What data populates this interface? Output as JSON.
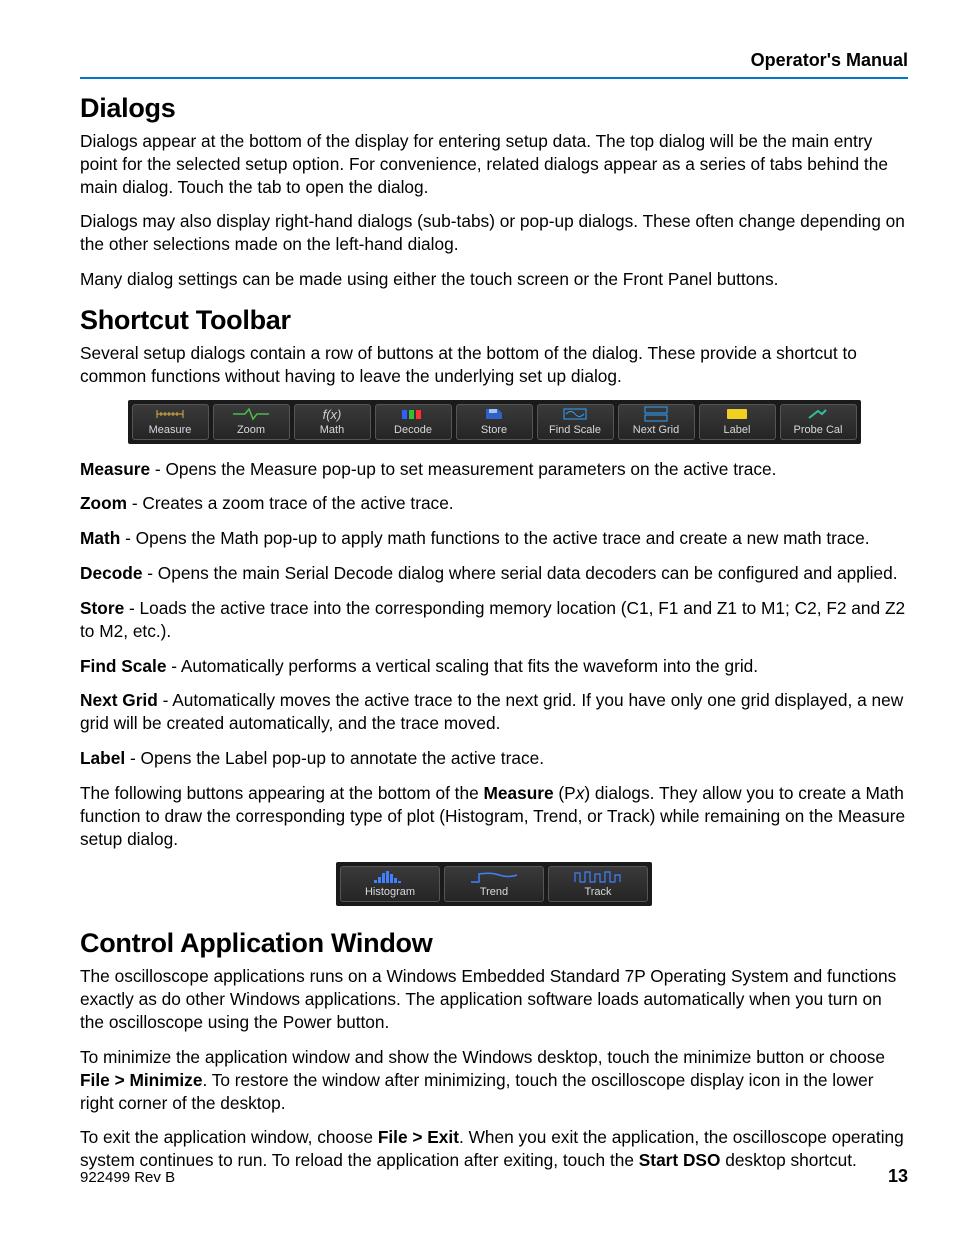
{
  "header": {
    "right": "Operator's Manual"
  },
  "sections": {
    "dialogs": {
      "title": "Dialogs",
      "p1": "Dialogs appear at the bottom of the display for entering setup data. The top dialog will be the main entry point for the selected setup option. For convenience, related dialogs appear as a series of tabs behind the main dialog. Touch the tab to open the dialog.",
      "p2": "Dialogs may also display right-hand dialogs (sub-tabs) or pop-up dialogs. These often change depending on the other selections made on the left-hand dialog.",
      "p3": "Many dialog settings can be made using either the touch screen or the Front Panel buttons."
    },
    "shortcut": {
      "title": "Shortcut Toolbar",
      "intro": "Several setup dialogs contain a row of buttons at the bottom of the dialog. These provide a shortcut to common functions without having to leave the underlying set up dialog.",
      "buttons": [
        "Measure",
        "Zoom",
        "Math",
        "Decode",
        "Store",
        "Find Scale",
        "Next Grid",
        "Label",
        "Probe Cal"
      ],
      "desc": {
        "measure": {
          "term": "Measure",
          "text": " - Opens the Measure pop-up to set measurement parameters on the active trace."
        },
        "zoom": {
          "term": "Zoom",
          "text": " - Creates a zoom trace of the active trace."
        },
        "math": {
          "term": "Math",
          "text": " - Opens the Math pop-up to apply math functions to the active trace and create a new math trace."
        },
        "decode": {
          "term": "Decode",
          "text": " - Opens the main Serial Decode dialog where serial data decoders can be configured and applied."
        },
        "store": {
          "term": "Store",
          "text": " - Loads the active trace into the corresponding memory location (C1, F1 and Z1 to M1; C2, F2 and Z2 to M2, etc.)."
        },
        "findscale": {
          "term": "Find Scale",
          "text": " - Automatically performs a vertical scaling that fits the waveform into the grid."
        },
        "nextgrid": {
          "term": "Next Grid",
          "text": " - Automatically moves the active trace to the next grid. If you have only one grid displayed, a new grid will be created automatically, and the trace moved."
        },
        "label": {
          "term": "Label",
          "text": " - Opens the Label pop-up to annotate the active trace."
        }
      },
      "measure_buttons_intro": {
        "pre": "The following buttons appearing at the bottom of the ",
        "bold": "Measure",
        "mid": " (P",
        "xvar": "x",
        "post": ") dialogs. They allow you to create a Math function to draw the corresponding type of plot (Histogram, Trend, or Track) while remaining on the Measure setup dialog."
      },
      "buttons2": [
        "Histogram",
        "Trend",
        "Track"
      ]
    },
    "control": {
      "title": "Control Application Window",
      "p1": "The oscilloscope applications runs on a Windows Embedded Standard 7P Operating System and functions exactly as do other Windows applications. The application software loads automatically when you turn on the oscilloscope using the Power button.",
      "p2a": "To minimize the application window and show the Windows desktop, touch the minimize button or choose ",
      "p2b": "File > Minimize",
      "p2c": ". To restore the window after minimizing, touch the oscilloscope display icon in the lower right corner of the desktop.",
      "p3a": "To exit the application window, choose ",
      "p3b": "File > Exit",
      "p3c": ". When you exit the application, the oscilloscope operating system continues to run. To reload the application after exiting, touch the ",
      "p3d": "Start DSO",
      "p3e": " desktop shortcut."
    }
  },
  "footer": {
    "left": "922499 Rev B",
    "page": "13"
  }
}
